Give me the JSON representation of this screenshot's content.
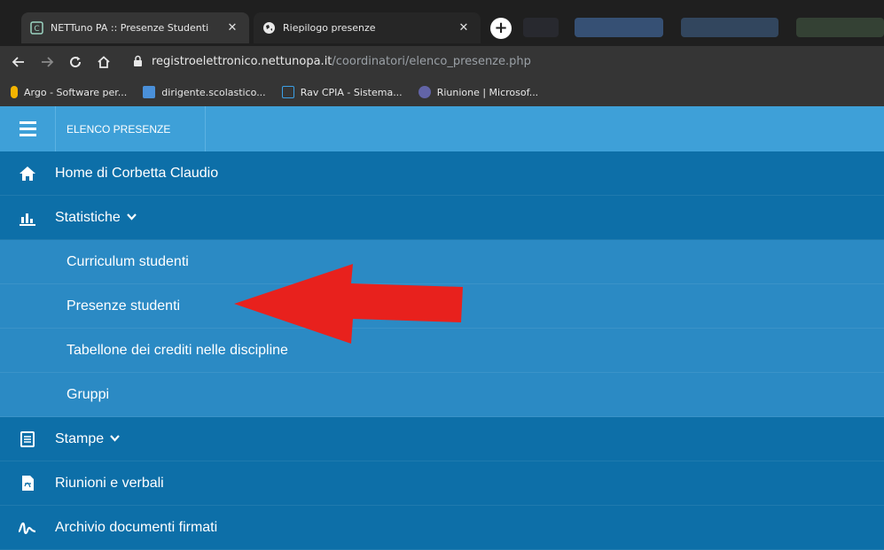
{
  "browser": {
    "tabs": [
      {
        "title": "NETTuno PA :: Presenze Studenti",
        "close": "✕",
        "active": true
      },
      {
        "title": "Riepilogo presenze",
        "close": "✕",
        "active": false
      }
    ],
    "new_tab": "+",
    "url_domain": "registroelettronico.nettunopa.it",
    "url_path": "/coordinatori/elenco_presenze.php",
    "bookmarks": [
      {
        "label": "Argo - Software per...",
        "color": "#f4b400"
      },
      {
        "label": "dirigente.scolastico...",
        "color": "#4a90d9"
      },
      {
        "label": "Rav CPIA - Sistema...",
        "color": "#3ca0e6"
      },
      {
        "label": "Riunione | Microsof...",
        "color": "#6264a7"
      }
    ]
  },
  "app": {
    "section_title": "ELENCO PRESENZE",
    "menu": [
      {
        "label": "Home di Corbetta Claudio",
        "icon": "home-icon",
        "level": "main"
      },
      {
        "label": "Statistiche",
        "icon": "bar-chart-icon",
        "level": "main",
        "chevron": "❯"
      },
      {
        "label": "Curriculum studenti",
        "level": "sub"
      },
      {
        "label": "Presenze studenti",
        "level": "sub"
      },
      {
        "label": "Tabellone dei crediti nelle discipline",
        "level": "sub"
      },
      {
        "label": "Gruppi",
        "level": "sub"
      },
      {
        "label": "Stampe",
        "icon": "document-icon",
        "level": "main",
        "chevron": "❯"
      },
      {
        "label": "Riunioni e verbali",
        "icon": "pdf-file-icon",
        "level": "main"
      },
      {
        "label": "Archivio documenti firmati",
        "icon": "signature-icon",
        "level": "main"
      }
    ],
    "colors": {
      "topbar": "#3ea0d8",
      "main_row": "#0d6fa8",
      "sub_row": "#2b8ac4",
      "arrow": "#e8211d"
    }
  }
}
